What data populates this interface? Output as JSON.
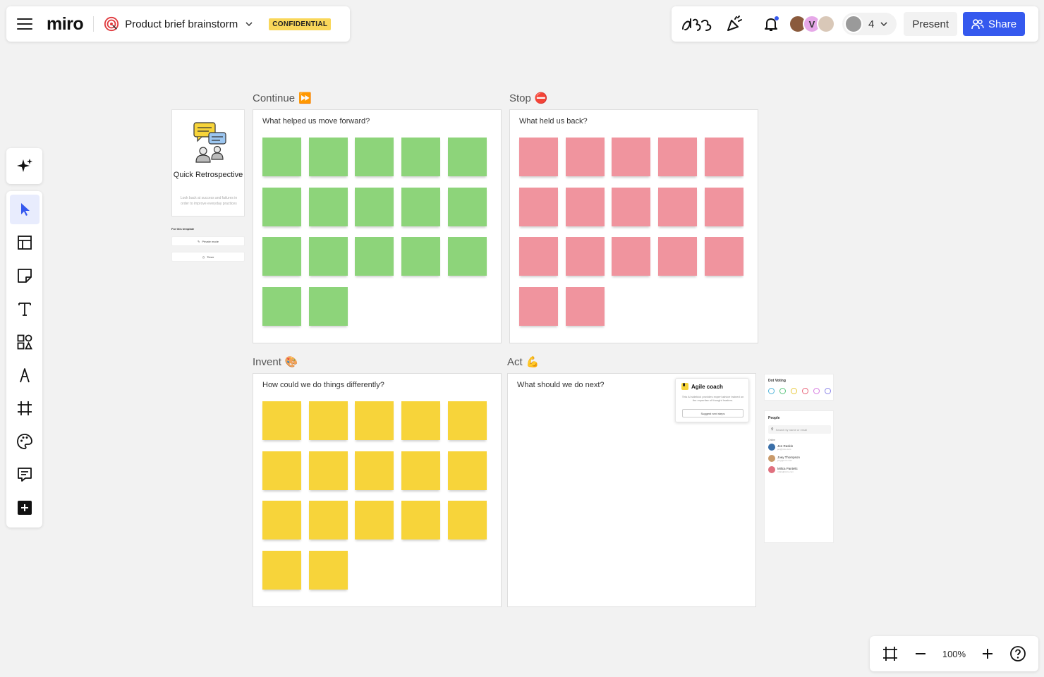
{
  "header": {
    "logo": "miro",
    "board_title": "Product brief brainstorm",
    "badge": "CONFIDENTIAL"
  },
  "toolbar_right": {
    "participants_count": "4",
    "present_label": "Present",
    "share_label": "Share",
    "avatar_letter": "V"
  },
  "sections": {
    "continue": {
      "title": "Continue",
      "emoji": "⏩",
      "question": "What helped us move forward?",
      "note_count": 17,
      "color": "#8dd47a"
    },
    "stop": {
      "title": "Stop",
      "emoji": "⛔",
      "question": "What held us back?",
      "note_count": 17,
      "color": "#f0949e"
    },
    "invent": {
      "title": "Invent",
      "emoji": "🎨",
      "question": "How could we do things differently?",
      "note_count": 17,
      "color": "#f7d43a"
    },
    "act": {
      "title": "Act",
      "emoji": "💪",
      "question": "What should we do next?"
    }
  },
  "template_card": {
    "title": "Quick Retrospective",
    "description": "Look back at success and failures in order to improve everyday practices",
    "for_template_label": "For this template",
    "private_mode_label": "Private mode",
    "timer_label": "Timer"
  },
  "agile_coach": {
    "title": "Agile coach",
    "description": "This AI sidekick provides expert advice trained on the expertise of thought leaders.",
    "button_label": "Suggest next steps"
  },
  "dot_voting": {
    "title": "Dot Voting",
    "dot_colors": [
      "#4fb3d9",
      "#5bc47e",
      "#e8c93a",
      "#e8657a",
      "#d77be0",
      "#8a84e8"
    ]
  },
  "people": {
    "title": "People",
    "search_placeholder": "Search by name or email",
    "online_label": "Online",
    "list": [
      {
        "name": "Jen Raskin",
        "email": "jen@miro.com",
        "color": "#3a6fa8"
      },
      {
        "name": "Joey Thompson",
        "email": "joey@miro.com",
        "color": "#c99a6a"
      },
      {
        "name": "Milica Pantelic",
        "email": "milica@miro.com",
        "color": "#e0707e"
      }
    ]
  },
  "zoom": {
    "level": "100%"
  }
}
